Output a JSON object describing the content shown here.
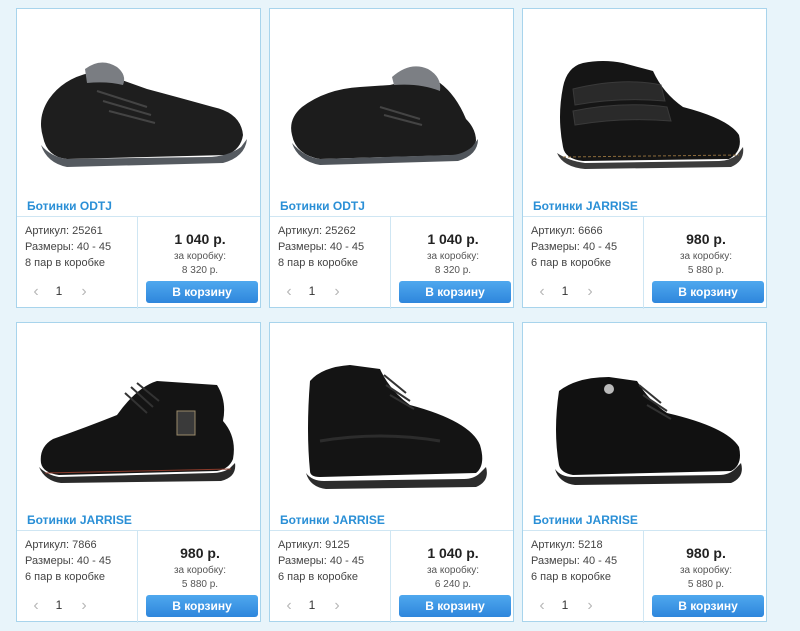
{
  "products": [
    {
      "title": "Ботинки ODTJ",
      "sku": "Артикул: 25261",
      "sizes": "Размеры: 40 - 45",
      "pack": "8 пар в коробке",
      "qty": "1",
      "price": "1 040 р.",
      "box_label": "за коробку:",
      "box_price": "8 320 р.",
      "button": "В корзину",
      "style": "fur-sneaker"
    },
    {
      "title": "Ботинки ODTJ",
      "sku": "Артикул: 25262",
      "sizes": "Размеры: 40 - 45",
      "pack": "8 пар в коробке",
      "qty": "1",
      "price": "1 040 р.",
      "box_label": "за коробку:",
      "box_price": "8 320 р.",
      "button": "В корзину",
      "style": "fur-slipon"
    },
    {
      "title": "Ботинки JARRISE",
      "sku": "Артикул: 6666",
      "sizes": "Размеры: 40 - 45",
      "pack": "6 пар в коробке",
      "qty": "1",
      "price": "980 р.",
      "box_label": "за коробку:",
      "box_price": "5 880 р.",
      "button": "В корзину",
      "style": "strap-boot"
    },
    {
      "title": "Ботинки JARRISE",
      "sku": "Артикул: 7866",
      "sizes": "Размеры: 40 - 45",
      "pack": "6 пар в коробке",
      "qty": "1",
      "price": "980 р.",
      "box_label": "за коробку:",
      "box_price": "5 880 р.",
      "button": "В корзину",
      "style": "lace-boot"
    },
    {
      "title": "Ботинки JARRISE",
      "sku": "Артикул: 9125",
      "sizes": "Размеры: 40 - 45",
      "pack": "6 пар в коробке",
      "qty": "1",
      "price": "1 040 р.",
      "box_label": "за коробку:",
      "box_price": "6 240 р.",
      "button": "В корзину",
      "style": "high-boot"
    },
    {
      "title": "Ботинки JARRISE",
      "sku": "Артикул: 5218",
      "sizes": "Размеры: 40 - 45",
      "pack": "6 пар в коробке",
      "qty": "1",
      "price": "980 р.",
      "box_label": "за коробку:",
      "box_price": "5 880 р.",
      "button": "В корзину",
      "style": "lace-boot"
    }
  ],
  "icons": {
    "prev": "chevron-left-icon",
    "next": "chevron-right-icon"
  },
  "colors": {
    "accent": "#2a8fd6",
    "button": "#3b93e3",
    "border": "#a8d4ec",
    "background": "#e8f4fa"
  }
}
